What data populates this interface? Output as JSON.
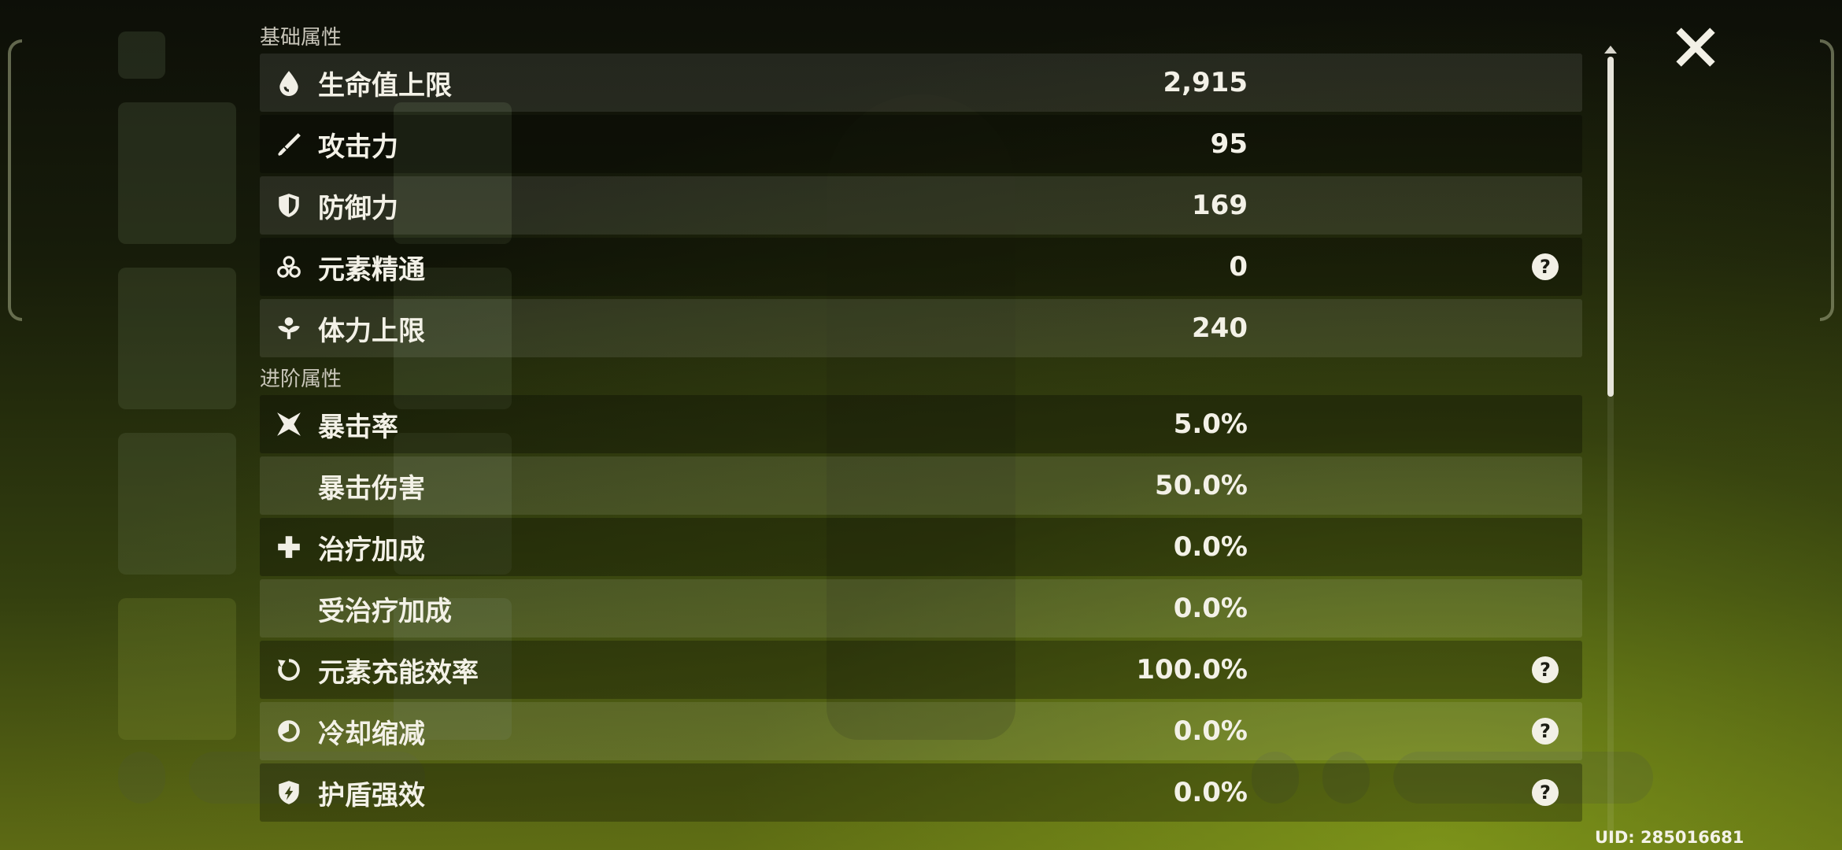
{
  "sections": {
    "base_title": "基础属性",
    "advanced_title": "进阶属性"
  },
  "base_stats": [
    {
      "icon": "water-drop-icon",
      "label": "生命值上限",
      "value": "2,915",
      "help": false
    },
    {
      "icon": "sword-icon",
      "label": "攻击力",
      "value": "95",
      "help": false
    },
    {
      "icon": "shield-icon",
      "label": "防御力",
      "value": "169",
      "help": false
    },
    {
      "icon": "elemental-mastery-icon",
      "label": "元素精通",
      "value": "0",
      "help": true
    },
    {
      "icon": "stamina-icon",
      "label": "体力上限",
      "value": "240",
      "help": false
    }
  ],
  "advanced_stats": [
    {
      "icon": "crit-star-icon",
      "label": "暴击率",
      "value": "5.0%",
      "help": false
    },
    {
      "icon": "",
      "label": "暴击伤害",
      "value": "50.0%",
      "help": false
    },
    {
      "icon": "healing-plus-icon",
      "label": "治疗加成",
      "value": "0.0%",
      "help": false
    },
    {
      "icon": "",
      "label": "受治疗加成",
      "value": "0.0%",
      "help": false
    },
    {
      "icon": "energy-recharge-icon",
      "label": "元素充能效率",
      "value": "100.0%",
      "help": true
    },
    {
      "icon": "cooldown-icon",
      "label": "冷却缩减",
      "value": "0.0%",
      "help": true
    },
    {
      "icon": "shield-strength-icon",
      "label": "护盾强效",
      "value": "0.0%",
      "help": true
    }
  ],
  "help_glyph": "?",
  "uid": "UID: 285016681",
  "scroll_position": 0.0,
  "colors": {
    "text": "#f3f1e7",
    "row_shade": "rgba(255,255,255,0.09)",
    "background_accent": "#5d6a14"
  }
}
